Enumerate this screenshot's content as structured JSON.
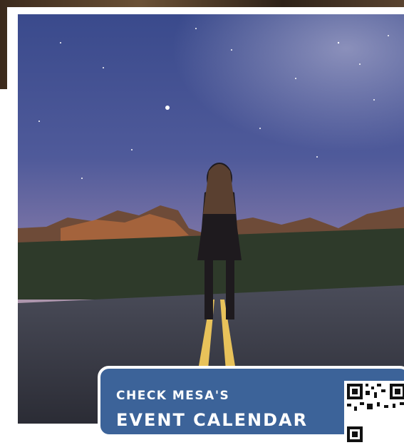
{
  "cta": {
    "line1": "CHECK MESA'S",
    "line2": "EVENT CALENDAR"
  },
  "colors": {
    "cta_background": "#3c6399",
    "card_border": "#ffffff"
  },
  "icons": {
    "qr": "qr-code-icon"
  }
}
